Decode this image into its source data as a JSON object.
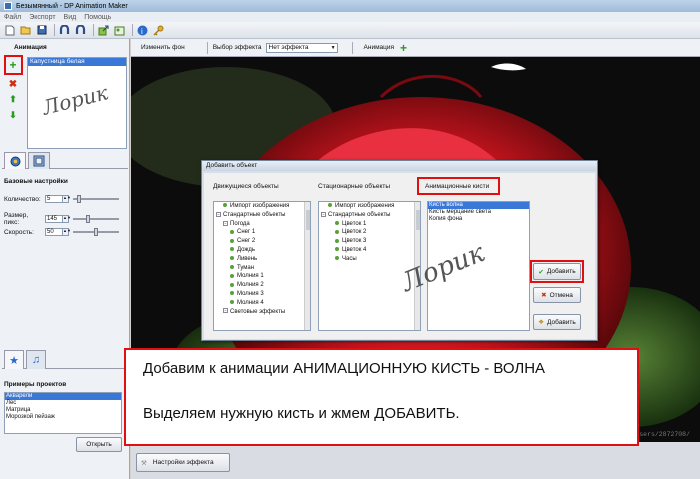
{
  "window": {
    "title": "Безымянный - DP Animation Maker"
  },
  "menu": [
    "Файл",
    "Экспорт",
    "Вид",
    "Помощь"
  ],
  "toolbar_icons": [
    "new-file-icon",
    "open-folder-icon",
    "save-icon",
    "magnet-icon",
    "magnet-icon",
    "export-icon",
    "export-image-icon",
    "info-icon",
    "key-icon"
  ],
  "left": {
    "animation_title": "Анимация",
    "animation_items": [
      "Капустница белая"
    ],
    "signature": "Лорик",
    "base_settings_title": "Базовые настройки",
    "settings": [
      {
        "label": "Количество:",
        "value": "5",
        "level": 0.1
      },
      {
        "label": "Размер, пикс:",
        "value": "145",
        "level": 0.3
      },
      {
        "label": "Скорость:",
        "value": "50",
        "level": 0.5
      }
    ],
    "examples_title": "Примеры проектов",
    "examples": [
      "Акварели",
      "Лес",
      "Матрица",
      "Морозкой пейзаж"
    ],
    "open_button": "Открыть"
  },
  "topbar": {
    "change_bg": "Изменить фон",
    "effect_select_label": "Выбор эффекта",
    "effect_value": "Нет эффекта",
    "animation_label": "Анимация"
  },
  "canvas": {
    "watermark": "http://www.liveinternet.ru/users/2872708/"
  },
  "bottom": {
    "effect_settings_button": "Настройки эффекта"
  },
  "dialog": {
    "title": "Добавить объект",
    "col_moving": "Движущиеся объекты",
    "col_static": "Стационарные объекты",
    "col_brushes": "Анимационные кисти",
    "moving_tree": [
      {
        "text": "Импорт изображения",
        "kind": "dot",
        "indent": 1
      },
      {
        "text": "Стандартные объекты",
        "kind": "exp",
        "indent": 0
      },
      {
        "text": "Погода",
        "kind": "exp",
        "indent": 1
      },
      {
        "text": "Снег 1",
        "kind": "dot",
        "indent": 2
      },
      {
        "text": "Снег 2",
        "kind": "dot",
        "indent": 2
      },
      {
        "text": "Дождь",
        "kind": "dot",
        "indent": 2
      },
      {
        "text": "Ливень",
        "kind": "dot",
        "indent": 2
      },
      {
        "text": "Туман",
        "kind": "dot",
        "indent": 2
      },
      {
        "text": "Молния 1",
        "kind": "dot",
        "indent": 2
      },
      {
        "text": "Молния 2",
        "kind": "dot",
        "indent": 2
      },
      {
        "text": "Молния 3",
        "kind": "dot",
        "indent": 2
      },
      {
        "text": "Молния 4",
        "kind": "dot",
        "indent": 2
      },
      {
        "text": "Световые эффекты",
        "kind": "exp",
        "indent": 1
      }
    ],
    "static_tree": [
      {
        "text": "Импорт изображения",
        "kind": "dot",
        "indent": 1
      },
      {
        "text": "Стандартные объекты",
        "kind": "exp",
        "indent": 0
      },
      {
        "text": "Цветок 1",
        "kind": "dot",
        "indent": 2
      },
      {
        "text": "Цветок 2",
        "kind": "dot",
        "indent": 2
      },
      {
        "text": "Цветок 3",
        "kind": "dot",
        "indent": 2
      },
      {
        "text": "Цветок 4",
        "kind": "dot",
        "indent": 2
      },
      {
        "text": "Часы",
        "kind": "dot",
        "indent": 2
      }
    ],
    "brushes": [
      "Кисть волна",
      "Кисть мерцание света",
      "Копия фона"
    ],
    "add_button": "Добавить",
    "cancel_button": "Отмена",
    "add_button2": "Добавить",
    "signature": "Лорик"
  },
  "annotation": {
    "line1": "Добавим к анимации АНИМАЦИОННУЮ КИСТЬ - ВОЛНА",
    "line2": "Выделяем нужную кисть и жмем ДОБАВИТЬ."
  },
  "colors": {
    "highlight_red": "#e01010",
    "selection_blue": "#3a78d8",
    "rose": "#c8141e"
  }
}
